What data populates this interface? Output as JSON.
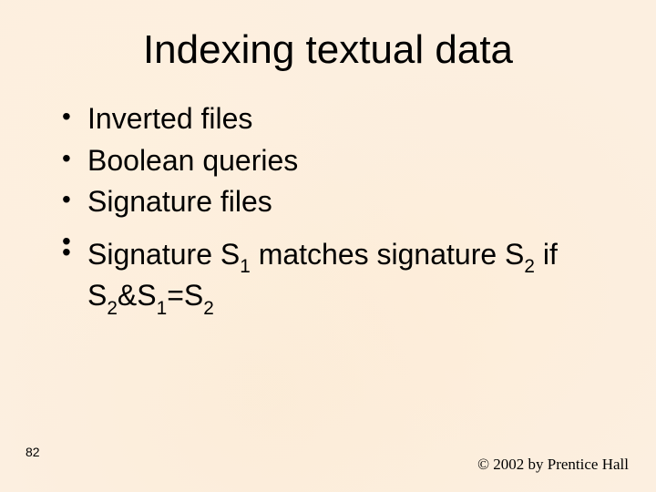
{
  "title": "Indexing textual data",
  "bullets": {
    "b1": "Inverted files",
    "b2": "Boolean queries",
    "b3": "Signature files",
    "b4_pre": "Signature S",
    "b4_sub1": "1",
    "b4_mid1": " matches signature S",
    "b4_sub2": "2",
    "b4_mid2": " if S",
    "b4_sub3": "2",
    "b4_amp": "&S",
    "b4_sub4": "1",
    "b4_eq": "=S",
    "b4_sub5": "2"
  },
  "page_number": "82",
  "copyright": "© 2002 by Prentice Hall"
}
